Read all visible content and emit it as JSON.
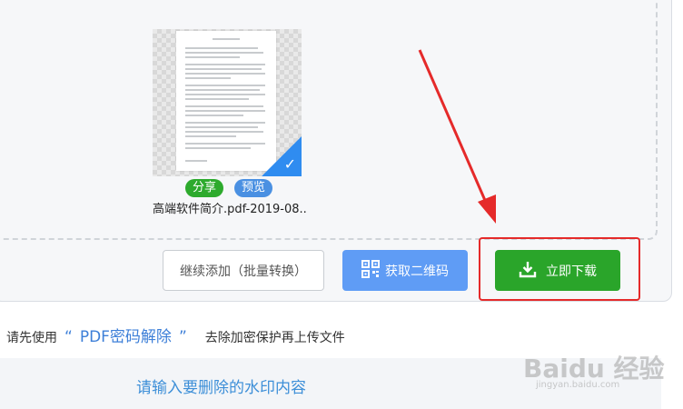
{
  "file": {
    "name": "高端软件简介.pdf-2019-08...",
    "share_label": "分享",
    "preview_label": "预览",
    "selected": true
  },
  "actions": {
    "continue_label": "继续添加（批量转换）",
    "qr_label": "获取二维码",
    "download_label": "立即下载"
  },
  "notice": {
    "prefix": "请先使用",
    "open_quote": "“",
    "link": "PDF密码解除",
    "close_quote": "”",
    "suffix": "去除加密保护再上传文件"
  },
  "watermark": {
    "placeholder": "请输入要删除的水印内容"
  },
  "branding": {
    "logo_text": "Baidu 经验",
    "url": "jingyan.baidu.com"
  },
  "colors": {
    "download": "#2aa52a",
    "qr": "#5f9cf5",
    "annotation": "#e52a2a"
  },
  "icons": {
    "qr": "qr-code-icon",
    "download": "download-icon",
    "check": "checkmark-icon"
  }
}
